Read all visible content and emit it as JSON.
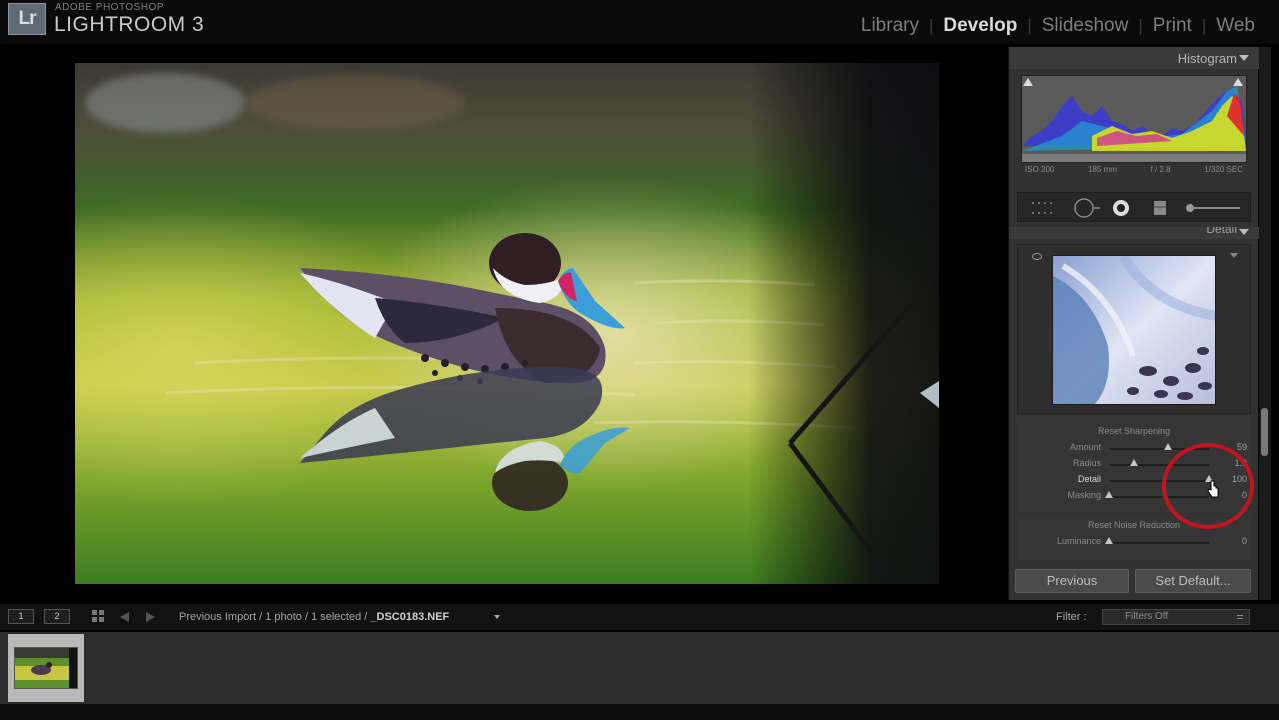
{
  "app": {
    "logo_text": "Lr",
    "brand_top": "ADOBE PHOTOSHOP",
    "brand_name": "LIGHTROOM 3"
  },
  "modules": [
    {
      "label": "Library",
      "active": false
    },
    {
      "label": "Develop",
      "active": true
    },
    {
      "label": "Slideshow",
      "active": false
    },
    {
      "label": "Print",
      "active": false
    },
    {
      "label": "Web",
      "active": false
    }
  ],
  "right_panel": {
    "histogram_title": "Histogram",
    "exif": [
      "ISO 200",
      "185 mm",
      "f / 2.8",
      "1/320 SEC"
    ],
    "detail_title": "Detail",
    "sharpening": {
      "section_label": "Reset Sharpening",
      "sliders": [
        {
          "label": "Amount",
          "value": "59",
          "position": 0.59
        },
        {
          "label": "Radius",
          "value": "1.0",
          "position": 0.25
        },
        {
          "label": "Detail",
          "value": "100",
          "position": 1.0
        },
        {
          "label": "Masking",
          "value": "0",
          "position": 0.0
        }
      ]
    },
    "noise": {
      "section_label": "Reset Noise Reduction",
      "sliders": [
        {
          "label": "Luminance",
          "value": "0",
          "position": 0.0
        }
      ]
    },
    "previous_button": "Previous",
    "set_default_button": "Set Default..."
  },
  "filmstrip": {
    "view_1": "1",
    "view_2": "2",
    "source_path": "Previous Import / 1 photo / 1 selected /",
    "file_name": "_DSC0183.NEF",
    "filter_label": "Filter :",
    "filter_value": "Filters Off"
  },
  "colors": {
    "annotation_circle": "#c0141f",
    "active_module": "#dadada",
    "panel_bg": "#323232"
  }
}
